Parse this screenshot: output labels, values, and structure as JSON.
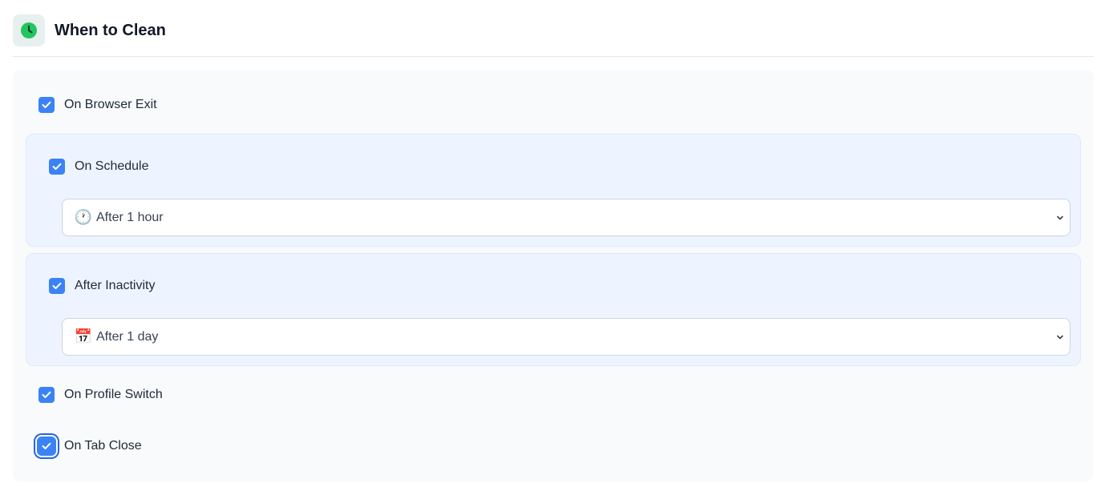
{
  "header": {
    "icon": "clock-icon",
    "title": "When to Clean",
    "accent": "#22c55e"
  },
  "options": {
    "browser_exit": {
      "label": "On Browser Exit",
      "checked": true
    },
    "schedule": {
      "label": "On Schedule",
      "checked": true,
      "select": {
        "icon": "🕐",
        "value": "After 1 hour"
      }
    },
    "inactivity": {
      "label": "After Inactivity",
      "checked": true,
      "select": {
        "icon": "📅",
        "value": "After 1 day"
      }
    },
    "profile_switch": {
      "label": "On Profile Switch",
      "checked": true
    },
    "tab_close": {
      "label": "On Tab Close",
      "checked": true,
      "focused": true
    }
  },
  "colors": {
    "checkbox": "#3b82f6",
    "group_bg": "#eef4ff",
    "panel_bg": "#f8fafc"
  }
}
